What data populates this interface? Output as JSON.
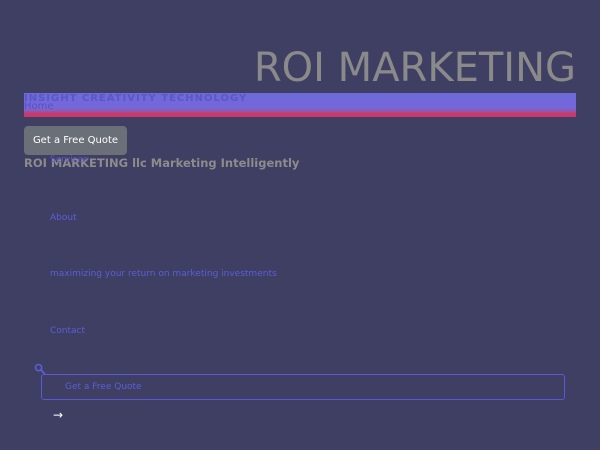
{
  "header": {
    "brand_title": "ROI MARKETING",
    "tagline": "INSIGHT CREATIVITY TECHNOLOGY",
    "tagline_ghost": "Home",
    "quote_button_label": "Get a Free Quote"
  },
  "subtitle": {
    "text": "ROI MARKETING llc Marketing Intelligently",
    "ghost": "Services"
  },
  "nav": {
    "items": [
      {
        "label": "About"
      },
      {
        "label": "maximizing your return on marketing investments"
      },
      {
        "label": "Contact"
      }
    ]
  },
  "search": {
    "icon": "search-icon"
  },
  "quote_box": {
    "label": "Get a Free Quote"
  },
  "arrow": {
    "glyph": "→"
  },
  "colors": {
    "background": "#3f3e63",
    "accent": "#5a5fd6",
    "banner_top": "#7467db",
    "banner_bottom": "#c83a6b",
    "button": "#6a6f78"
  }
}
